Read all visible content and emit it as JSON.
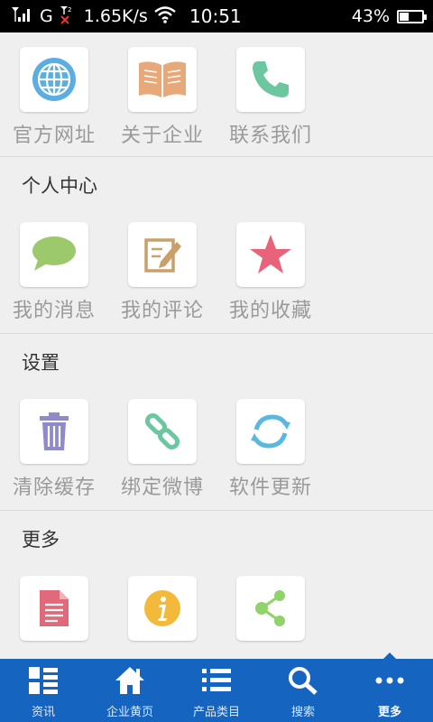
{
  "status_bar": {
    "network": "G",
    "speed": "1.65K/s",
    "time": "10:51",
    "battery": "43%"
  },
  "sections": [
    {
      "title": "",
      "items": [
        {
          "label": "官方网址",
          "icon": "globe-icon",
          "color": "#5aaee2"
        },
        {
          "label": "关于企业",
          "icon": "book-icon",
          "color": "#e8a97a"
        },
        {
          "label": "联系我们",
          "icon": "phone-icon",
          "color": "#6cc6a0"
        }
      ]
    },
    {
      "title": "个人中心",
      "items": [
        {
          "label": "我的消息",
          "icon": "speech-bubble-icon",
          "color": "#9cc96b"
        },
        {
          "label": "我的评论",
          "icon": "edit-note-icon",
          "color": "#c9a06a"
        },
        {
          "label": "我的收藏",
          "icon": "star-icon",
          "color": "#e8637a"
        }
      ]
    },
    {
      "title": "设置",
      "items": [
        {
          "label": "清除缓存",
          "icon": "trash-icon",
          "color": "#8f8ac9"
        },
        {
          "label": "绑定微博",
          "icon": "link-icon",
          "color": "#6cc6a0"
        },
        {
          "label": "软件更新",
          "icon": "refresh-icon",
          "color": "#5ab8de"
        }
      ]
    },
    {
      "title": "更多",
      "items": [
        {
          "label": "",
          "icon": "document-icon",
          "color": "#e06a7a"
        },
        {
          "label": "",
          "icon": "info-icon",
          "color": "#f3b93a"
        },
        {
          "label": "",
          "icon": "share-icon",
          "color": "#8fd36a"
        }
      ]
    }
  ],
  "bottom_nav": [
    {
      "label": "资讯",
      "icon": "grid-list-icon"
    },
    {
      "label": "企业黄页",
      "icon": "home-icon"
    },
    {
      "label": "产品类目",
      "icon": "list-icon"
    },
    {
      "label": "搜索",
      "icon": "search-icon"
    },
    {
      "label": "更多",
      "icon": "more-icon",
      "active": true
    }
  ],
  "colors": {
    "nav_background": "#1565c0",
    "page_background": "#efefef"
  }
}
